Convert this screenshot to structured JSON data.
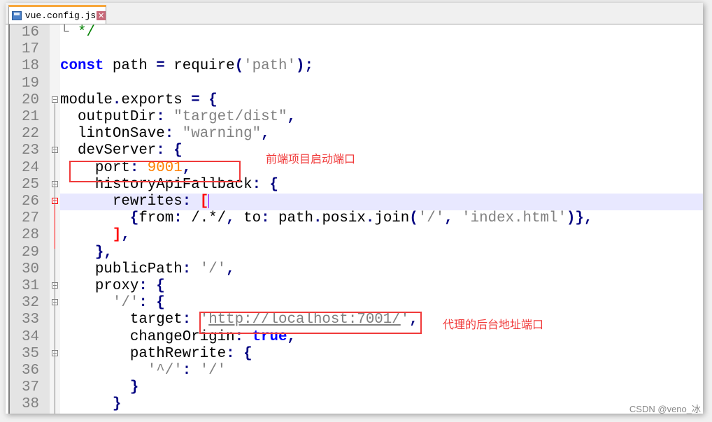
{
  "tab": {
    "title": "vue.config.js",
    "icon": "save-icon",
    "close_icon": "close-icon",
    "close_glyph": "✕"
  },
  "first_line": 16,
  "highlighted_line": 26,
  "lines": [
    [
      {
        "t": "└ ",
        "c": "str"
      },
      {
        "t": "*/",
        "c": "com"
      }
    ],
    [],
    [
      {
        "t": "const",
        "c": "kw"
      },
      {
        "t": " path ",
        "c": "id"
      },
      {
        "t": "=",
        "c": "op"
      },
      {
        "t": " require",
        "c": "id"
      },
      {
        "t": "(",
        "c": "op"
      },
      {
        "t": "'path'",
        "c": "str"
      },
      {
        "t": ");",
        "c": "op"
      }
    ],
    [],
    [
      {
        "t": "module",
        "c": "id"
      },
      {
        "t": ".",
        "c": "op"
      },
      {
        "t": "exports ",
        "c": "id"
      },
      {
        "t": "=",
        "c": "op"
      },
      {
        "t": " ",
        "c": "id"
      },
      {
        "t": "{",
        "c": "op"
      }
    ],
    [
      {
        "t": "  outputDir",
        "c": "id"
      },
      {
        "t": ":",
        "c": "op"
      },
      {
        "t": " \"target/dist\"",
        "c": "str"
      },
      {
        "t": ",",
        "c": "op"
      }
    ],
    [
      {
        "t": "  lintOnSave",
        "c": "id"
      },
      {
        "t": ":",
        "c": "op"
      },
      {
        "t": " \"warning\"",
        "c": "str"
      },
      {
        "t": ",",
        "c": "op"
      }
    ],
    [
      {
        "t": "  devServer",
        "c": "id"
      },
      {
        "t": ":",
        "c": "op"
      },
      {
        "t": " ",
        "c": "id"
      },
      {
        "t": "{",
        "c": "op"
      }
    ],
    [
      {
        "t": "    port",
        "c": "id"
      },
      {
        "t": ":",
        "c": "op"
      },
      {
        "t": " 9001",
        "c": "num"
      },
      {
        "t": ",",
        "c": "op"
      }
    ],
    [
      {
        "t": "    historyApiFallback",
        "c": "id"
      },
      {
        "t": ":",
        "c": "op"
      },
      {
        "t": " ",
        "c": "id"
      },
      {
        "t": "{",
        "c": "op"
      }
    ],
    [
      {
        "t": "      rewrites",
        "c": "id"
      },
      {
        "t": ":",
        "c": "op"
      },
      {
        "t": " ",
        "c": "id"
      },
      {
        "t": "[",
        "c": "err"
      }
    ],
    [
      {
        "t": "        ",
        "c": "id"
      },
      {
        "t": "{",
        "c": "op"
      },
      {
        "t": "from",
        "c": "id"
      },
      {
        "t": ":",
        "c": "op"
      },
      {
        "t": " /.*/",
        "c": "id"
      },
      {
        "t": ",",
        "c": "op"
      },
      {
        "t": " to",
        "c": "id"
      },
      {
        "t": ":",
        "c": "op"
      },
      {
        "t": " path",
        "c": "id"
      },
      {
        "t": ".",
        "c": "op"
      },
      {
        "t": "posix",
        "c": "id"
      },
      {
        "t": ".",
        "c": "op"
      },
      {
        "t": "join",
        "c": "id"
      },
      {
        "t": "(",
        "c": "op"
      },
      {
        "t": "'/'",
        "c": "str"
      },
      {
        "t": ",",
        "c": "op"
      },
      {
        "t": " 'index.html'",
        "c": "str"
      },
      {
        "t": ")},",
        "c": "op"
      }
    ],
    [
      {
        "t": "      ",
        "c": "id"
      },
      {
        "t": "]",
        "c": "err"
      },
      {
        "t": ",",
        "c": "op"
      }
    ],
    [
      {
        "t": "    ",
        "c": "id"
      },
      {
        "t": "},",
        "c": "op"
      }
    ],
    [
      {
        "t": "    publicPath",
        "c": "id"
      },
      {
        "t": ":",
        "c": "op"
      },
      {
        "t": " '/'",
        "c": "str"
      },
      {
        "t": ",",
        "c": "op"
      }
    ],
    [
      {
        "t": "    proxy",
        "c": "id"
      },
      {
        "t": ":",
        "c": "op"
      },
      {
        "t": " ",
        "c": "id"
      },
      {
        "t": "{",
        "c": "op"
      }
    ],
    [
      {
        "t": "      '/'",
        "c": "str"
      },
      {
        "t": ":",
        "c": "op"
      },
      {
        "t": " ",
        "c": "id"
      },
      {
        "t": "{",
        "c": "op"
      }
    ],
    [
      {
        "t": "        target",
        "c": "id"
      },
      {
        "t": ":",
        "c": "op"
      },
      {
        "t": " '",
        "c": "str"
      },
      {
        "t": "http://localhost:7001/",
        "c": "url"
      },
      {
        "t": "'",
        "c": "str"
      },
      {
        "t": ",",
        "c": "op"
      }
    ],
    [
      {
        "t": "        changeOrigin",
        "c": "id"
      },
      {
        "t": ":",
        "c": "op"
      },
      {
        "t": " ",
        "c": "id"
      },
      {
        "t": "true",
        "c": "kw"
      },
      {
        "t": ",",
        "c": "op"
      }
    ],
    [
      {
        "t": "        pathRewrite",
        "c": "id"
      },
      {
        "t": ":",
        "c": "op"
      },
      {
        "t": " ",
        "c": "id"
      },
      {
        "t": "{",
        "c": "op"
      }
    ],
    [
      {
        "t": "          '^/'",
        "c": "str"
      },
      {
        "t": ":",
        "c": "op"
      },
      {
        "t": " '/'",
        "c": "str"
      }
    ],
    [
      {
        "t": "        ",
        "c": "id"
      },
      {
        "t": "}",
        "c": "op"
      }
    ],
    [
      {
        "t": "      ",
        "c": "id"
      },
      {
        "t": "}",
        "c": "op"
      }
    ]
  ],
  "fold_markers": [
    20,
    23,
    25,
    26,
    31,
    32,
    35
  ],
  "annotations": {
    "port_note": "前端项目启动端口",
    "proxy_note": "代理的后台地址端口",
    "color": "#f03a3a"
  },
  "watermark": "CSDN @veno_冰"
}
